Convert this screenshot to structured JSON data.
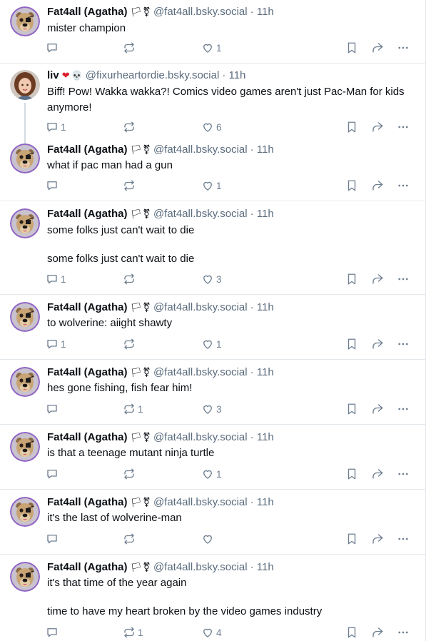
{
  "posts": [
    {
      "display_name": "Fat4all (Agatha)",
      "emoji": [
        "🏳",
        "⚧"
      ],
      "handle": "@fat4all.bsky.social",
      "time": "· 11h",
      "text": [
        "mister champion"
      ],
      "replies": "",
      "reposts": "",
      "likes": "1",
      "avatar": "dog"
    },
    {
      "display_name": "liv",
      "emoji": [
        "❤",
        "💀"
      ],
      "handle": "@fixurheartordie.bsky.social",
      "time": "· 11h",
      "text": [
        "Biff! Pow! Wakka wakka?! Comics video games aren't just Pac-Man for kids anymore!"
      ],
      "replies": "1",
      "reposts": "",
      "likes": "6",
      "avatar": "person"
    },
    {
      "display_name": "Fat4all (Agatha)",
      "emoji": [
        "🏳",
        "⚧"
      ],
      "handle": "@fat4all.bsky.social",
      "time": "· 11h",
      "text": [
        "what if pac man had a gun"
      ],
      "replies": "",
      "reposts": "",
      "likes": "1",
      "avatar": "dog"
    },
    {
      "display_name": "Fat4all (Agatha)",
      "emoji": [
        "🏳",
        "⚧"
      ],
      "handle": "@fat4all.bsky.social",
      "time": "· 11h",
      "text": [
        "some folks just can't wait to die",
        "some folks just can't wait to die"
      ],
      "replies": "1",
      "reposts": "",
      "likes": "3",
      "avatar": "dog"
    },
    {
      "display_name": "Fat4all (Agatha)",
      "emoji": [
        "🏳",
        "⚧"
      ],
      "handle": "@fat4all.bsky.social",
      "time": "· 11h",
      "text": [
        "to wolverine: aiight shawty"
      ],
      "replies": "1",
      "reposts": "",
      "likes": "1",
      "avatar": "dog"
    },
    {
      "display_name": "Fat4all (Agatha)",
      "emoji": [
        "🏳",
        "⚧"
      ],
      "handle": "@fat4all.bsky.social",
      "time": "· 11h",
      "text": [
        "hes gone fishing, fish fear him!"
      ],
      "replies": "",
      "reposts": "1",
      "likes": "3",
      "avatar": "dog"
    },
    {
      "display_name": "Fat4all (Agatha)",
      "emoji": [
        "🏳",
        "⚧"
      ],
      "handle": "@fat4all.bsky.social",
      "time": "· 11h",
      "text": [
        "is that a teenage mutant ninja turtle"
      ],
      "replies": "",
      "reposts": "",
      "likes": "1",
      "avatar": "dog"
    },
    {
      "display_name": "Fat4all (Agatha)",
      "emoji": [
        "🏳",
        "⚧"
      ],
      "handle": "@fat4all.bsky.social",
      "time": "· 11h",
      "text": [
        "it's the last of wolverine-man"
      ],
      "replies": "",
      "reposts": "",
      "likes": "",
      "avatar": "dog"
    },
    {
      "display_name": "Fat4all (Agatha)",
      "emoji": [
        "🏳",
        "⚧"
      ],
      "handle": "@fat4all.bsky.social",
      "time": "· 11h",
      "text": [
        "it's that time of the year again",
        "time to have my heart broken by the video games industry"
      ],
      "replies": "",
      "reposts": "1",
      "likes": "4",
      "avatar": "dog"
    }
  ],
  "icons": {
    "reply": "reply-icon",
    "repost": "repost-icon",
    "like": "heart-icon",
    "bookmark": "bookmark-icon",
    "share": "share-icon",
    "more": "more-icon"
  },
  "colors": {
    "text": "#0b0f14",
    "muted": "#5a6b7d",
    "icon": "#6f7f90",
    "divider": "#e3e8ed",
    "heart_emoji": "#d8202b"
  }
}
